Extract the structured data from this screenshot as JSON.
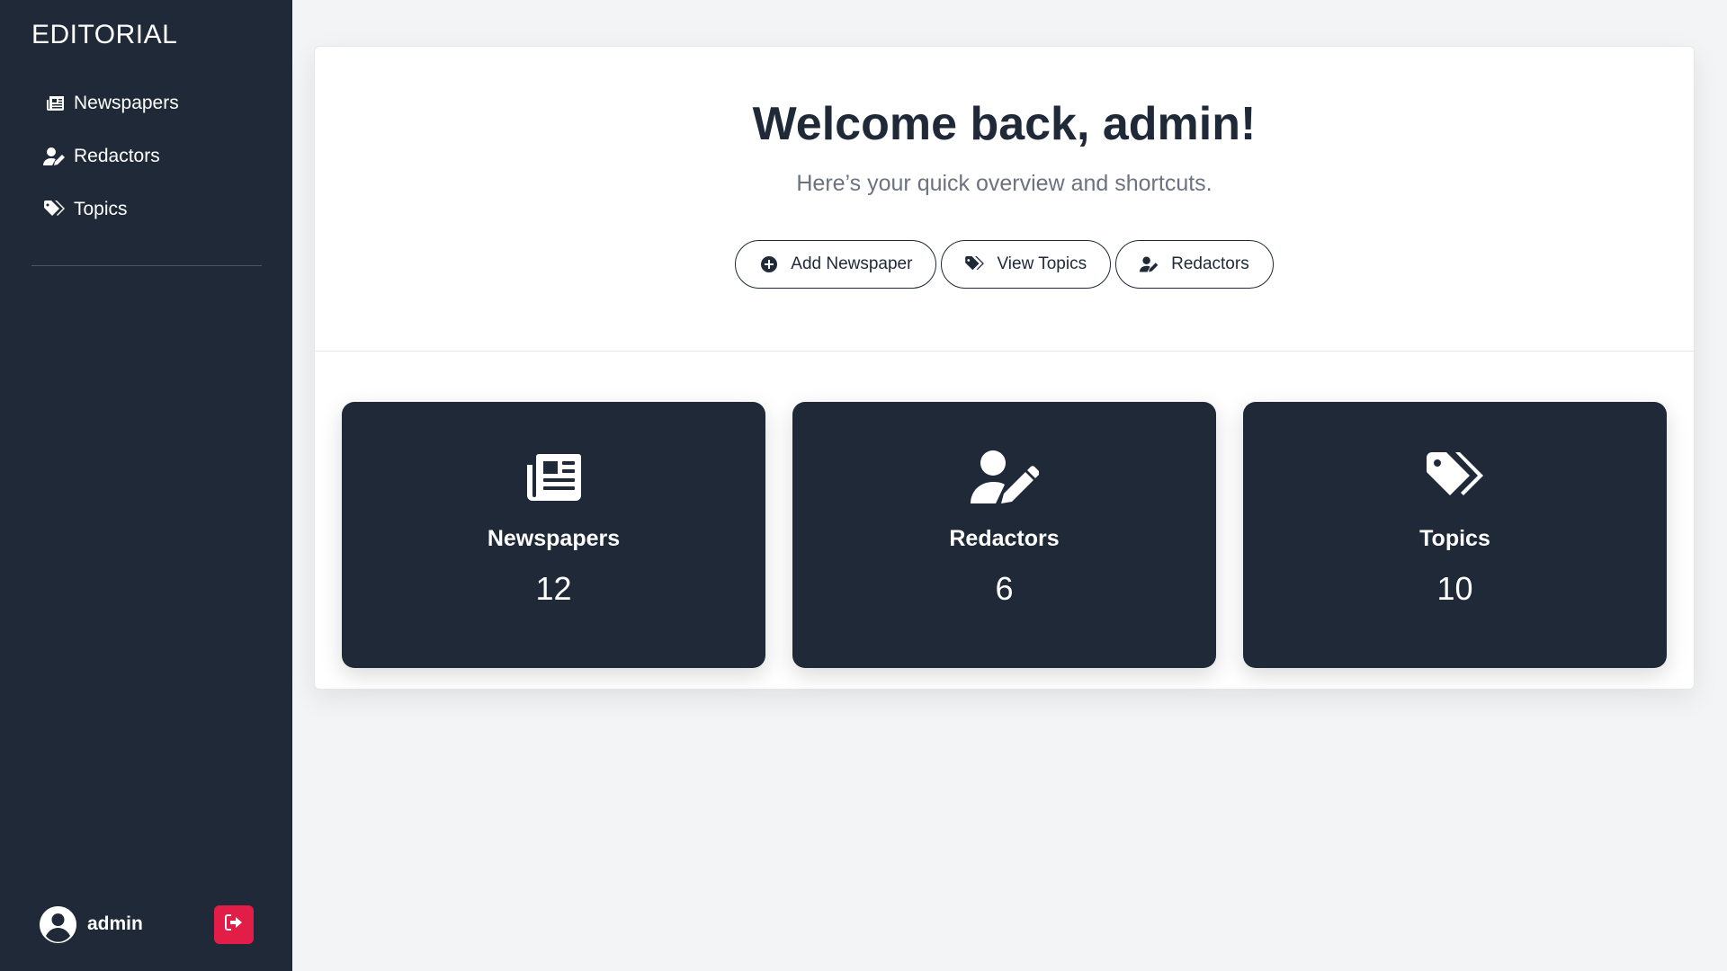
{
  "sidebar": {
    "brand": "EDITORIAL",
    "items": [
      {
        "label": "Newspapers",
        "icon": "newspaper-icon"
      },
      {
        "label": "Redactors",
        "icon": "user-pen-icon"
      },
      {
        "label": "Topics",
        "icon": "tags-icon"
      }
    ],
    "user": {
      "name": "admin",
      "icon": "user-circle-icon"
    },
    "logout_icon": "logout-icon"
  },
  "main": {
    "title": "Welcome back, admin!",
    "subtitle": "Here’s your quick overview and shortcuts.",
    "actions": [
      {
        "label": "Add Newspaper",
        "icon": "plus-circle-icon"
      },
      {
        "label": "View Topics",
        "icon": "tags-icon"
      },
      {
        "label": "Redactors",
        "icon": "user-pen-icon"
      }
    ],
    "stats": [
      {
        "label": "Newspapers",
        "value": "12",
        "icon": "newspaper-icon"
      },
      {
        "label": "Redactors",
        "value": "6",
        "icon": "user-pen-icon"
      },
      {
        "label": "Topics",
        "value": "10",
        "icon": "tags-icon"
      }
    ]
  },
  "colors": {
    "sidebar_bg": "#1f2937",
    "card_bg": "#1f2937",
    "page_bg": "#f3f4f6",
    "logout_bg": "#e11d48",
    "text_dark": "#1f2937",
    "text_muted": "#6b7280"
  }
}
